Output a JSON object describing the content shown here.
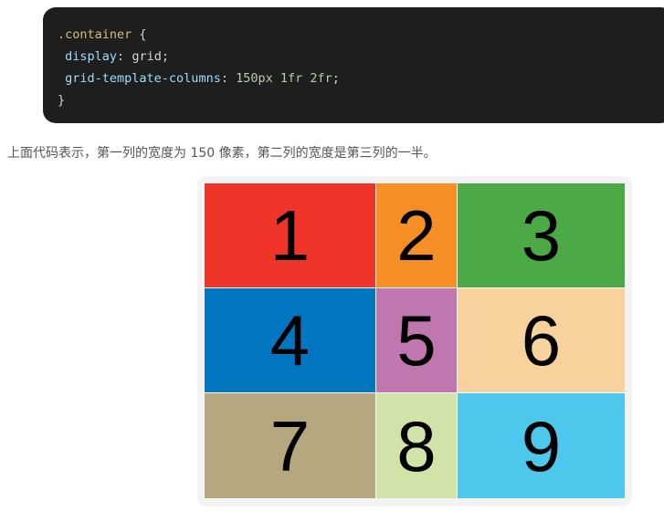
{
  "code": {
    "selector": ".container",
    "open_brace": " {",
    "decl1_prop": "display",
    "decl1_value": "grid;",
    "decl2_prop": "grid-template-columns",
    "decl2_n1": "150px",
    "decl2_n2": "1fr",
    "decl2_n3": "2fr",
    "decl2_end": ";",
    "close_brace": "}"
  },
  "description": "上面代码表示，第一列的宽度为 150 像素，第二列的宽度是第三列的一半。",
  "grid_items": [
    {
      "label": "1",
      "color": "#ef342a"
    },
    {
      "label": "2",
      "color": "#f68f26"
    },
    {
      "label": "3",
      "color": "#4ba946"
    },
    {
      "label": "4",
      "color": "#0376c2"
    },
    {
      "label": "5",
      "color": "#c077af"
    },
    {
      "label": "6",
      "color": "#f8d29d"
    },
    {
      "label": "7",
      "color": "#b5a87f"
    },
    {
      "label": "8",
      "color": "#d0e4a9"
    },
    {
      "label": "9",
      "color": "#4dc7ec"
    }
  ]
}
